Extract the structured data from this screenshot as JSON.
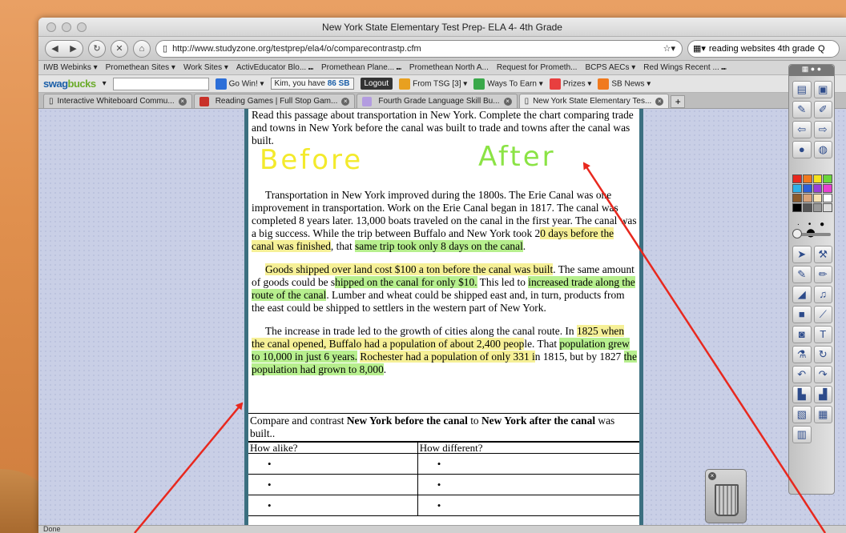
{
  "window": {
    "title": "New York State Elementary Test Prep- ELA 4- 4th Grade"
  },
  "navigation": {
    "url": "http://www.studyzone.org/testprep/ela4/o/comparecontrastp.cfm",
    "search_text": "reading websites 4th grade",
    "search_glyph": "Q"
  },
  "bookmarks": [
    "IWB Webinks ▾",
    "Promethean Sites ▾",
    "Work Sites ▾",
    "ActivEducator Blo... ⑉",
    "Promethean Plane... ⑉",
    "Promethean North A...",
    "Request for Prometh...",
    "BCPS AECs ▾",
    "Red Wings Recent ... ⑉"
  ],
  "toolbar": {
    "logo_a": "swag",
    "logo_b": "bucks",
    "go_win": "Go Win! ▾",
    "sb_prefix": "Kim, you have ",
    "sb_count": "86 SB",
    "logout": "Logout",
    "from_tsg": "From TSG [3] ▾",
    "ways_to_earn": "Ways To Earn ▾",
    "prizes": "Prizes ▾",
    "sb_news": "SB News ▾"
  },
  "tabs": [
    {
      "label": "Interactive Whiteboard Commu..."
    },
    {
      "label": "Reading Games | Full Stop Gam..."
    },
    {
      "label": "Fourth Grade Language Skill Bu..."
    },
    {
      "label": "New York State Elementary Tes..."
    }
  ],
  "tab_add": "+",
  "passage": {
    "instructions": "Read this passage about transportation in New York. Complete the chart comparing trade and towns in New York before the canal was built to trade and towns after the canal was built.",
    "before_label": "Before",
    "after_label": "After",
    "p1_a": "Transportation in New York improved during the 1800s. The Erie Canal was one improvement in transportation. Work on the Erie Canal began in 1817. The canal was completed 8 years later. 13,000 boats traveled on the canal in the first year. The canal was a big success. While the trip between Buffalo and New York took 2",
    "p1_hl1": "0 days before the canal was finished",
    "p1_b": ", that ",
    "p1_hl2": "same trip took only 8 days on the canal",
    "p1_c": ".",
    "p2_hl1": "Goods shipped over land cost $100 a ton before the canal was built",
    "p2_a": ". The same amount of goods could be s",
    "p2_hl2": "hipped on the canal for only $10.",
    "p2_b": " This led to ",
    "p2_hl3": "increased trade along the route of the canal",
    "p2_c": ". Lumber and wheat could be shipped east and, in turn, products from the east could be shipped to settlers in the western part of New York.",
    "p3_a": "The increase in trade led to the growth of cities along the canal route. In ",
    "p3_hl1": "1825 when the canal opened, Buffalo had a population of about 2,400 peop",
    "p3_b": "le. That ",
    "p3_hl2": "population grew to 10,000 in just 6 years.",
    "p3_c": " ",
    "p3_hl3": "Rochester had a population of only 331 i",
    "p3_d": "n 1815, but by 1827 ",
    "p3_hl4": "the population had grown to 8,000",
    "p3_e": "."
  },
  "compare": {
    "q_a": "Compare and contrast ",
    "q_b": "New York before the canal",
    "q_c": " to ",
    "q_d": "New York after the canal",
    "q_e": " was built..",
    "col_alike": "How alike?",
    "col_different": "How different?",
    "bullet": "•"
  },
  "status": {
    "text": "Done"
  },
  "colors": {
    "highlight_yellow": "#f6f097",
    "highlight_green": "#b7ef8e",
    "pen_yellow": "#f3ea2c",
    "pen_green": "#8be345",
    "arrow_red": "#e8281e",
    "page_border": "#3b6f80"
  },
  "palette": {
    "swatches": [
      "#e8281e",
      "#f07a1e",
      "#f5e21e",
      "#6ad63b",
      "#2fb1e8",
      "#2d5fd8",
      "#9a3fd8",
      "#e83fd1",
      "#8b5a2b",
      "#d8a37a",
      "#f7e3b5",
      "#ffffff",
      "#000000",
      "#555555",
      "#999999",
      "#dddddd"
    ],
    "tools": [
      "page-icon",
      "presentation-icon",
      "pen-mode-icon",
      "annotate-desktop-icon",
      "back-icon",
      "forward-icon",
      "record-icon",
      "globe-icon",
      "select-icon",
      "tools-icon",
      "pen-icon",
      "highlighter-icon",
      "eraser-icon",
      "bell-icon",
      "shape-icon",
      "connector-icon",
      "camera-icon",
      "text-icon",
      "flask-icon",
      "refresh-icon",
      "undo-icon",
      "redo-icon",
      "chart-icon",
      "chart-bar-icon",
      "clapper-icon",
      "spreadsheet-icon",
      "document-icon"
    ]
  }
}
